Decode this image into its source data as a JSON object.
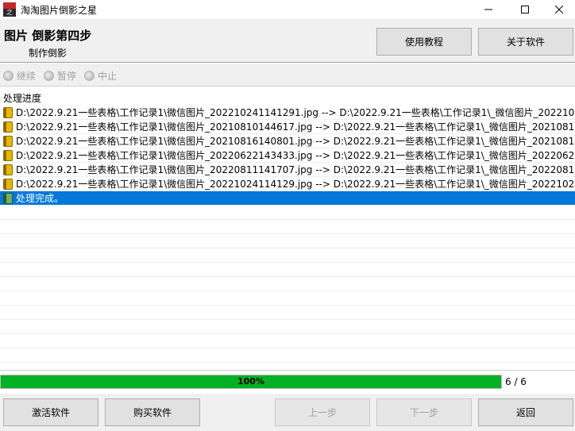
{
  "window": {
    "title": "淘淘图片倒影之星",
    "icon_top": "之",
    "icon_bottom": "星"
  },
  "header": {
    "step_title": "图片 倒影第四步",
    "step_subtitle": "制作倒影",
    "tutorial_label": "使用教程",
    "about_label": "关于软件"
  },
  "controls": {
    "continue_label": "继续",
    "pause_label": "暂停",
    "stop_label": "中止"
  },
  "progress_section": {
    "label": "处理进度",
    "log": [
      "D:\\2022.9.21一些表格\\工作记录1\\微信图片_202210241141291.jpg  -->  D:\\2022.9.21一些表格\\工作记录1\\_微信图片_202210...",
      "D:\\2022.9.21一些表格\\工作记录1\\微信图片_20210810144617.jpg  -->  D:\\2022.9.21一些表格\\工作记录1\\_微信图片_2021081...",
      "D:\\2022.9.21一些表格\\工作记录1\\微信图片_20210816140801.jpg  -->  D:\\2022.9.21一些表格\\工作记录1\\_微信图片_2021081...",
      "D:\\2022.9.21一些表格\\工作记录1\\微信图片_20220622143433.jpg  -->  D:\\2022.9.21一些表格\\工作记录1\\_微信图片_2022062...",
      "D:\\2022.9.21一些表格\\工作记录1\\微信图片_20220811141707.jpg  -->  D:\\2022.9.21一些表格\\工作记录1\\_微信图片_2022081...",
      "D:\\2022.9.21一些表格\\工作记录1\\微信图片_20221024114129.jpg  -->  D:\\2022.9.21一些表格\\工作记录1\\_微信图片_2022102..."
    ],
    "complete_text": "处理完成。",
    "progress_percent": 100,
    "progress_text": "100%",
    "count_text": "6 / 6"
  },
  "footer": {
    "activate_label": "激活软件",
    "buy_label": "购买软件",
    "prev_label": "上一步",
    "next_label": "下一步",
    "back_label": "返回"
  },
  "colors": {
    "selection": "#0078d7",
    "progress_fill": "#06b025",
    "chrome": "#f0f0f0"
  }
}
